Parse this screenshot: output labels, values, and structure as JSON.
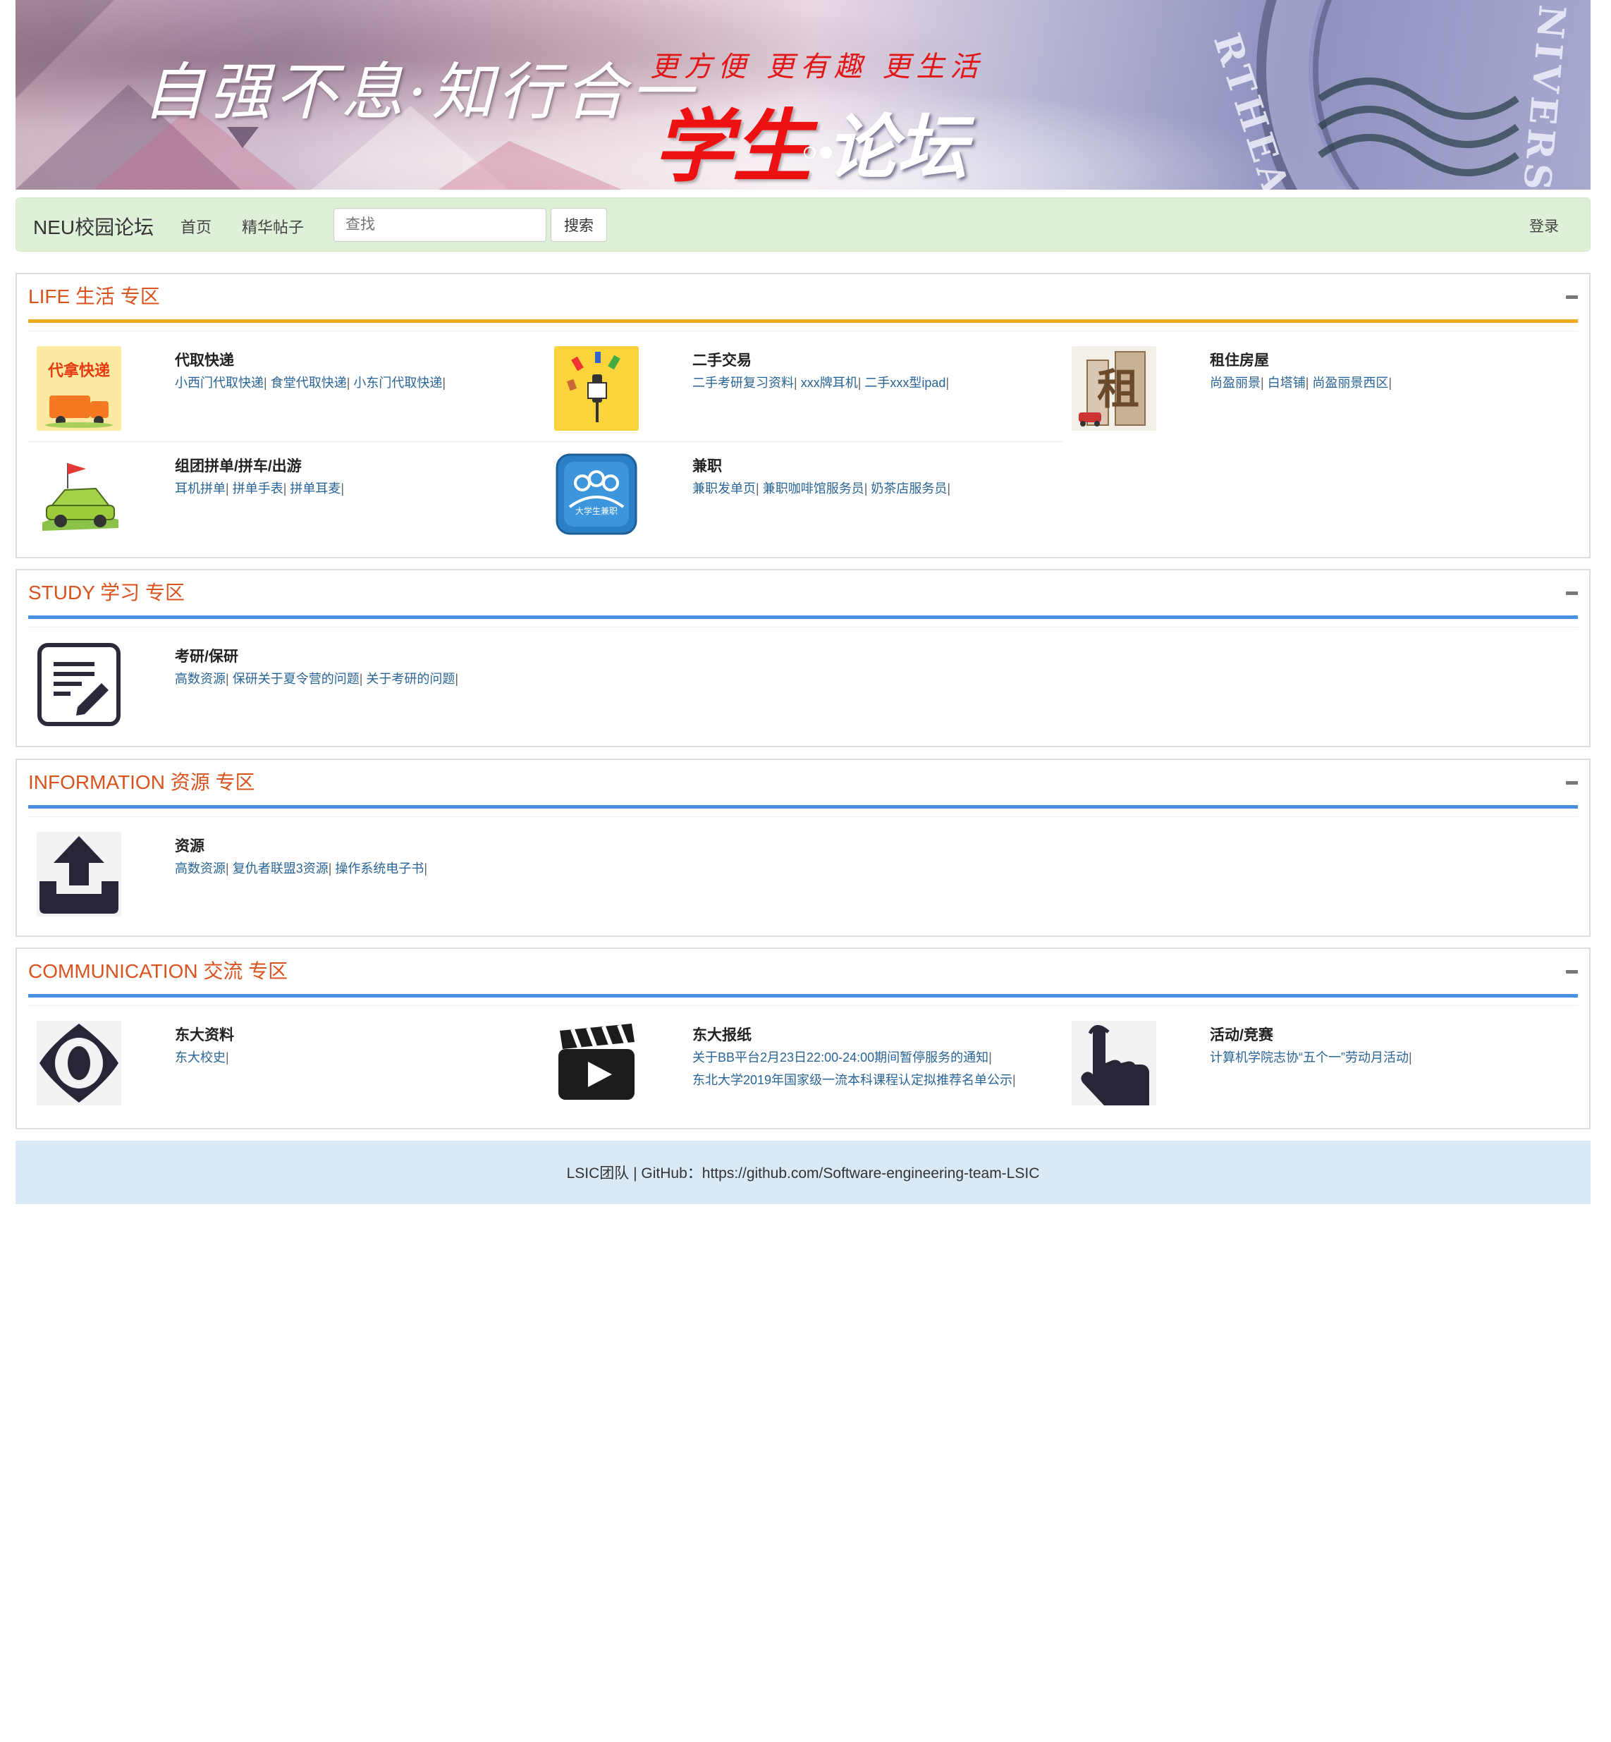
{
  "banner": {
    "slogan_left": "自强不息·知行合一",
    "slogan_small": "更方便 更有趣 更生活",
    "title_red": "学生",
    "title_white": "论坛",
    "seal_text_left": "RTHEASTER",
    "seal_text_right": "NIVERSI",
    "carousel_count": 2,
    "carousel_active": 2
  },
  "navbar": {
    "brand": "NEU校园论坛",
    "links": [
      "首页",
      "精华帖子"
    ],
    "search_placeholder": "查找",
    "search_button": "搜索",
    "login": "登录"
  },
  "sections": [
    {
      "title": "LIFE 生活 专区",
      "accent": "#f0a81c",
      "items": [
        {
          "name": "代取快递",
          "links": [
            "小西门代取快递",
            "食堂代取快递",
            "小东门代取快递"
          ],
          "icon": "delivery-truck-icon",
          "thumb_text": "代拿快递"
        },
        {
          "name": "二手交易",
          "links": [
            "二手考研复习资料",
            "xxx牌耳机",
            "二手xxx型ipad"
          ],
          "icon": "trade-icon"
        },
        {
          "name": "租住房屋",
          "links": [
            "尚盈丽景",
            "白塔铺",
            "尚盈丽景西区"
          ],
          "icon": "rent-building-icon",
          "thumb_text": "租"
        },
        {
          "name": "组团拼单/拼车/出游",
          "links": [
            "耳机拼单",
            "拼单手表",
            "拼单耳麦"
          ],
          "icon": "car-trip-icon"
        },
        {
          "name": "兼职",
          "links": [
            "兼职发单页",
            "兼职咖啡馆服务员",
            "奶茶店服务员"
          ],
          "icon": "part-time-icon",
          "thumb_text": "大学生兼职"
        }
      ]
    },
    {
      "title": "STUDY 学习 专区",
      "accent": "#4a90e2",
      "items": [
        {
          "name": "考研/保研",
          "links": [
            "高数资源",
            "保研关于夏令营的问题",
            "关于考研的问题"
          ],
          "icon": "edit-note-icon"
        }
      ]
    },
    {
      "title": "INFORMATION 资源 专区",
      "accent": "#4a90e2",
      "items": [
        {
          "name": "资源",
          "links": [
            "高数资源",
            "复仇者联盟3资源",
            "操作系统电子书"
          ],
          "icon": "upload-icon"
        }
      ]
    },
    {
      "title": "COMMUNICATION 交流 专区",
      "accent": "#4a90e2",
      "items": [
        {
          "name": "东大资料",
          "links": [
            "东大校史"
          ],
          "icon": "eye-icon"
        },
        {
          "name": "东大报纸",
          "links": [
            "关于BB平台2月23日22:00-24:00期间暂停服务的通知",
            "东北大学2019年国家级一流本科课程认定拟推荐名单公示"
          ],
          "icon": "video-clapper-icon",
          "stacked": true
        },
        {
          "name": "活动/竞赛",
          "links": [
            "计算机学院志协“五个一”劳动月活动"
          ],
          "icon": "pointer-hand-icon"
        }
      ]
    }
  ],
  "footer": {
    "text": "LSIC团队 | GitHub：https://github.com/Software-engineering-team-LSIC"
  },
  "colors": {
    "navbar_bg": "#dff0d8",
    "section_title": "#d9531e",
    "link": "#2a6496",
    "footer_bg": "#d9eaf6"
  }
}
